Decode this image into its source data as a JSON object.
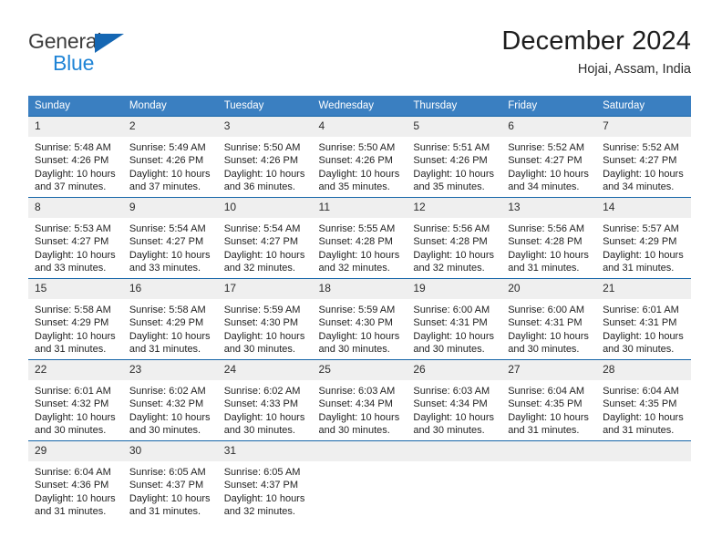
{
  "brand": {
    "line1": "General",
    "line2": "Blue",
    "triangle_color": "#1567b3",
    "blue_text_color": "#1f84d6"
  },
  "header": {
    "title": "December 2024",
    "location": "Hojai, Assam, India"
  },
  "calendar": {
    "header_bg": "#3a7fc1",
    "row_divider_color": "#1565a8",
    "daynum_bg": "#efefef",
    "weekdays": [
      "Sunday",
      "Monday",
      "Tuesday",
      "Wednesday",
      "Thursday",
      "Friday",
      "Saturday"
    ],
    "weeks": [
      [
        {
          "day": "1",
          "sunrise": "Sunrise: 5:48 AM",
          "sunset": "Sunset: 4:26 PM",
          "daylight1": "Daylight: 10 hours",
          "daylight2": "and 37 minutes."
        },
        {
          "day": "2",
          "sunrise": "Sunrise: 5:49 AM",
          "sunset": "Sunset: 4:26 PM",
          "daylight1": "Daylight: 10 hours",
          "daylight2": "and 37 minutes."
        },
        {
          "day": "3",
          "sunrise": "Sunrise: 5:50 AM",
          "sunset": "Sunset: 4:26 PM",
          "daylight1": "Daylight: 10 hours",
          "daylight2": "and 36 minutes."
        },
        {
          "day": "4",
          "sunrise": "Sunrise: 5:50 AM",
          "sunset": "Sunset: 4:26 PM",
          "daylight1": "Daylight: 10 hours",
          "daylight2": "and 35 minutes."
        },
        {
          "day": "5",
          "sunrise": "Sunrise: 5:51 AM",
          "sunset": "Sunset: 4:26 PM",
          "daylight1": "Daylight: 10 hours",
          "daylight2": "and 35 minutes."
        },
        {
          "day": "6",
          "sunrise": "Sunrise: 5:52 AM",
          "sunset": "Sunset: 4:27 PM",
          "daylight1": "Daylight: 10 hours",
          "daylight2": "and 34 minutes."
        },
        {
          "day": "7",
          "sunrise": "Sunrise: 5:52 AM",
          "sunset": "Sunset: 4:27 PM",
          "daylight1": "Daylight: 10 hours",
          "daylight2": "and 34 minutes."
        }
      ],
      [
        {
          "day": "8",
          "sunrise": "Sunrise: 5:53 AM",
          "sunset": "Sunset: 4:27 PM",
          "daylight1": "Daylight: 10 hours",
          "daylight2": "and 33 minutes."
        },
        {
          "day": "9",
          "sunrise": "Sunrise: 5:54 AM",
          "sunset": "Sunset: 4:27 PM",
          "daylight1": "Daylight: 10 hours",
          "daylight2": "and 33 minutes."
        },
        {
          "day": "10",
          "sunrise": "Sunrise: 5:54 AM",
          "sunset": "Sunset: 4:27 PM",
          "daylight1": "Daylight: 10 hours",
          "daylight2": "and 32 minutes."
        },
        {
          "day": "11",
          "sunrise": "Sunrise: 5:55 AM",
          "sunset": "Sunset: 4:28 PM",
          "daylight1": "Daylight: 10 hours",
          "daylight2": "and 32 minutes."
        },
        {
          "day": "12",
          "sunrise": "Sunrise: 5:56 AM",
          "sunset": "Sunset: 4:28 PM",
          "daylight1": "Daylight: 10 hours",
          "daylight2": "and 32 minutes."
        },
        {
          "day": "13",
          "sunrise": "Sunrise: 5:56 AM",
          "sunset": "Sunset: 4:28 PM",
          "daylight1": "Daylight: 10 hours",
          "daylight2": "and 31 minutes."
        },
        {
          "day": "14",
          "sunrise": "Sunrise: 5:57 AM",
          "sunset": "Sunset: 4:29 PM",
          "daylight1": "Daylight: 10 hours",
          "daylight2": "and 31 minutes."
        }
      ],
      [
        {
          "day": "15",
          "sunrise": "Sunrise: 5:58 AM",
          "sunset": "Sunset: 4:29 PM",
          "daylight1": "Daylight: 10 hours",
          "daylight2": "and 31 minutes."
        },
        {
          "day": "16",
          "sunrise": "Sunrise: 5:58 AM",
          "sunset": "Sunset: 4:29 PM",
          "daylight1": "Daylight: 10 hours",
          "daylight2": "and 31 minutes."
        },
        {
          "day": "17",
          "sunrise": "Sunrise: 5:59 AM",
          "sunset": "Sunset: 4:30 PM",
          "daylight1": "Daylight: 10 hours",
          "daylight2": "and 30 minutes."
        },
        {
          "day": "18",
          "sunrise": "Sunrise: 5:59 AM",
          "sunset": "Sunset: 4:30 PM",
          "daylight1": "Daylight: 10 hours",
          "daylight2": "and 30 minutes."
        },
        {
          "day": "19",
          "sunrise": "Sunrise: 6:00 AM",
          "sunset": "Sunset: 4:31 PM",
          "daylight1": "Daylight: 10 hours",
          "daylight2": "and 30 minutes."
        },
        {
          "day": "20",
          "sunrise": "Sunrise: 6:00 AM",
          "sunset": "Sunset: 4:31 PM",
          "daylight1": "Daylight: 10 hours",
          "daylight2": "and 30 minutes."
        },
        {
          "day": "21",
          "sunrise": "Sunrise: 6:01 AM",
          "sunset": "Sunset: 4:31 PM",
          "daylight1": "Daylight: 10 hours",
          "daylight2": "and 30 minutes."
        }
      ],
      [
        {
          "day": "22",
          "sunrise": "Sunrise: 6:01 AM",
          "sunset": "Sunset: 4:32 PM",
          "daylight1": "Daylight: 10 hours",
          "daylight2": "and 30 minutes."
        },
        {
          "day": "23",
          "sunrise": "Sunrise: 6:02 AM",
          "sunset": "Sunset: 4:32 PM",
          "daylight1": "Daylight: 10 hours",
          "daylight2": "and 30 minutes."
        },
        {
          "day": "24",
          "sunrise": "Sunrise: 6:02 AM",
          "sunset": "Sunset: 4:33 PM",
          "daylight1": "Daylight: 10 hours",
          "daylight2": "and 30 minutes."
        },
        {
          "day": "25",
          "sunrise": "Sunrise: 6:03 AM",
          "sunset": "Sunset: 4:34 PM",
          "daylight1": "Daylight: 10 hours",
          "daylight2": "and 30 minutes."
        },
        {
          "day": "26",
          "sunrise": "Sunrise: 6:03 AM",
          "sunset": "Sunset: 4:34 PM",
          "daylight1": "Daylight: 10 hours",
          "daylight2": "and 30 minutes."
        },
        {
          "day": "27",
          "sunrise": "Sunrise: 6:04 AM",
          "sunset": "Sunset: 4:35 PM",
          "daylight1": "Daylight: 10 hours",
          "daylight2": "and 31 minutes."
        },
        {
          "day": "28",
          "sunrise": "Sunrise: 6:04 AM",
          "sunset": "Sunset: 4:35 PM",
          "daylight1": "Daylight: 10 hours",
          "daylight2": "and 31 minutes."
        }
      ],
      [
        {
          "day": "29",
          "sunrise": "Sunrise: 6:04 AM",
          "sunset": "Sunset: 4:36 PM",
          "daylight1": "Daylight: 10 hours",
          "daylight2": "and 31 minutes."
        },
        {
          "day": "30",
          "sunrise": "Sunrise: 6:05 AM",
          "sunset": "Sunset: 4:37 PM",
          "daylight1": "Daylight: 10 hours",
          "daylight2": "and 31 minutes."
        },
        {
          "day": "31",
          "sunrise": "Sunrise: 6:05 AM",
          "sunset": "Sunset: 4:37 PM",
          "daylight1": "Daylight: 10 hours",
          "daylight2": "and 32 minutes."
        },
        {
          "day": "",
          "sunrise": "",
          "sunset": "",
          "daylight1": "",
          "daylight2": ""
        },
        {
          "day": "",
          "sunrise": "",
          "sunset": "",
          "daylight1": "",
          "daylight2": ""
        },
        {
          "day": "",
          "sunrise": "",
          "sunset": "",
          "daylight1": "",
          "daylight2": ""
        },
        {
          "day": "",
          "sunrise": "",
          "sunset": "",
          "daylight1": "",
          "daylight2": ""
        }
      ]
    ]
  }
}
